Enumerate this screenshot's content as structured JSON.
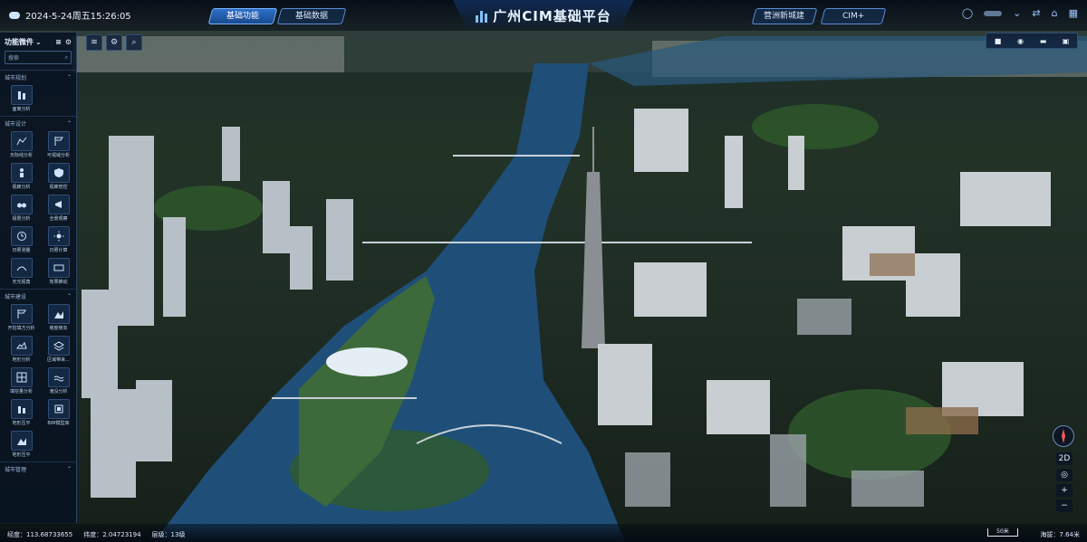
{
  "topbar": {
    "datetime": "2024-5-24周五15:26:05",
    "tabs": [
      {
        "label": "基础功能",
        "active": true
      },
      {
        "label": "基础数据",
        "active": false
      }
    ],
    "title": "广州CIM基础平台",
    "right_tabs": [
      {
        "label": "营洲新城建"
      },
      {
        "label": "CIM+"
      }
    ]
  },
  "leftpanel": {
    "header": "功能微件",
    "search_placeholder": "搜索",
    "sections": [
      {
        "name": "城市规划",
        "tools": [
          "面离分析"
        ]
      },
      {
        "name": "城市设计",
        "tools": [
          "天际线分析",
          "可视域分析",
          "视廊分析",
          "视廊管控",
          "极限分析",
          "全景观察",
          "日照测量",
          "日照计算",
          "天光视角",
          "效果推动"
        ]
      },
      {
        "name": "城市建设",
        "tools": [
          "开挖填方分析",
          "坡度坡向",
          "地形分析",
          "区域带来...",
          "填挖量分析",
          "淹没分析",
          "地形压平",
          "BIM模型库",
          "地形压平"
        ]
      },
      {
        "name": "城市管理",
        "tools": []
      }
    ]
  },
  "viewcontrols": [
    "camera-icon",
    "eye-icon",
    "layer-icon",
    "fullscreen-icon"
  ],
  "compass": {
    "mode_label": "2D"
  },
  "statusbar": {
    "longitude": "经度：113.68733655",
    "latitude": "纬度：2.04723194",
    "level": "层级：13级",
    "scale": "50米",
    "altitude": "海拔：7.64米"
  },
  "colors": {
    "accent": "#2c6fc8",
    "panel_bg": "#08121f",
    "river": "#1f4f78"
  }
}
